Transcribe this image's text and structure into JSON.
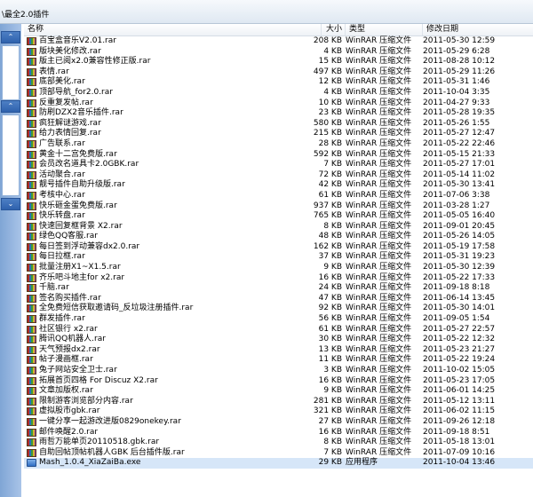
{
  "window": {
    "path": "\\最全2.0插件"
  },
  "columns": {
    "name": "名称",
    "size": "大小",
    "type": "类型",
    "date": "修改日期"
  },
  "nav": {
    "up": "⌃",
    "down": "⌄"
  },
  "files": [
    {
      "name": "百宝盒音乐V2.01.rar",
      "size": "208 KB",
      "type": "WinRAR 压缩文件",
      "date": "2011-05-30 12:59"
    },
    {
      "name": "版块美化修改.rar",
      "size": "4 KB",
      "type": "WinRAR 压缩文件",
      "date": "2011-05-29 6:28"
    },
    {
      "name": "版主已阅x2.0兼容性修正版.rar",
      "size": "15 KB",
      "type": "WinRAR 压缩文件",
      "date": "2011-08-28 10:12"
    },
    {
      "name": "表情.rar",
      "size": "497 KB",
      "type": "WinRAR 压缩文件",
      "date": "2011-05-29 11:26"
    },
    {
      "name": "底部美化.rar",
      "size": "12 KB",
      "type": "WinRAR 压缩文件",
      "date": "2011-05-31 1:46"
    },
    {
      "name": "顶部导航_for2.0.rar",
      "size": "4 KB",
      "type": "WinRAR 压缩文件",
      "date": "2011-10-04 3:35"
    },
    {
      "name": "反重复发帖.rar",
      "size": "10 KB",
      "type": "WinRAR 压缩文件",
      "date": "2011-04-27 9:33"
    },
    {
      "name": "防刷DZX2音乐插件.rar",
      "size": "23 KB",
      "type": "WinRAR 压缩文件",
      "date": "2011-05-28 19:35"
    },
    {
      "name": "疯狂解谜游戏.rar",
      "size": "580 KB",
      "type": "WinRAR 压缩文件",
      "date": "2011-05-26 1:55"
    },
    {
      "name": "给力表情回复.rar",
      "size": "215 KB",
      "type": "WinRAR 压缩文件",
      "date": "2011-05-27 12:47"
    },
    {
      "name": "广告联系.rar",
      "size": "28 KB",
      "type": "WinRAR 压缩文件",
      "date": "2011-05-22 22:46"
    },
    {
      "name": "黄金十二宫免费版.rar",
      "size": "592 KB",
      "type": "WinRAR 压缩文件",
      "date": "2011-05-15 21:33"
    },
    {
      "name": "会员改名道具卡2.0GBK.rar",
      "size": "7 KB",
      "type": "WinRAR 压缩文件",
      "date": "2011-05-27 17:01"
    },
    {
      "name": "活动聚合.rar",
      "size": "72 KB",
      "type": "WinRAR 压缩文件",
      "date": "2011-05-14 11:02"
    },
    {
      "name": "靓号插件自助升级版.rar",
      "size": "42 KB",
      "type": "WinRAR 压缩文件",
      "date": "2011-05-30 13:41"
    },
    {
      "name": "考核中心.rar",
      "size": "61 KB",
      "type": "WinRAR 压缩文件",
      "date": "2011-07-06 3:38"
    },
    {
      "name": "快乐砸金蛋免费版.rar",
      "size": "937 KB",
      "type": "WinRAR 压缩文件",
      "date": "2011-03-28 1:27"
    },
    {
      "name": "快乐转盘.rar",
      "size": "765 KB",
      "type": "WinRAR 压缩文件",
      "date": "2011-05-05 16:40"
    },
    {
      "name": "快速回复框背景 X2.rar",
      "size": "8 KB",
      "type": "WinRAR 压缩文件",
      "date": "2011-09-01 20:45"
    },
    {
      "name": "绿色QQ客服.rar",
      "size": "48 KB",
      "type": "WinRAR 压缩文件",
      "date": "2011-05-26 14:05"
    },
    {
      "name": "每日签到浮动兼容dx2.0.rar",
      "size": "162 KB",
      "type": "WinRAR 压缩文件",
      "date": "2011-05-19 17:58"
    },
    {
      "name": "每日拉框.rar",
      "size": "37 KB",
      "type": "WinRAR 压缩文件",
      "date": "2011-05-31 19:23"
    },
    {
      "name": "批量注册X1~X1.5.rar",
      "size": "9 KB",
      "type": "WinRAR 压缩文件",
      "date": "2011-05-30 12:39"
    },
    {
      "name": "齐乐吧斗地主for x2.rar",
      "size": "16 KB",
      "type": "WinRAR 压缩文件",
      "date": "2011-05-22 17:33"
    },
    {
      "name": "千脑.rar",
      "size": "24 KB",
      "type": "WinRAR 压缩文件",
      "date": "2011-09-18 8:18"
    },
    {
      "name": "签名购买插件.rar",
      "size": "47 KB",
      "type": "WinRAR 压缩文件",
      "date": "2011-06-14 13:45"
    },
    {
      "name": "全免费短信获取邀请码_反垃圾注册插件.rar",
      "size": "92 KB",
      "type": "WinRAR 压缩文件",
      "date": "2011-05-30 14:01"
    },
    {
      "name": "群发插件.rar",
      "size": "56 KB",
      "type": "WinRAR 压缩文件",
      "date": "2011-09-05 1:54"
    },
    {
      "name": "社区银行 x2.rar",
      "size": "61 KB",
      "type": "WinRAR 压缩文件",
      "date": "2011-05-27 22:57"
    },
    {
      "name": "腾讯QQ机器人.rar",
      "size": "30 KB",
      "type": "WinRAR 压缩文件",
      "date": "2011-05-22 12:32"
    },
    {
      "name": "天气预报dx2.rar",
      "size": "13 KB",
      "type": "WinRAR 压缩文件",
      "date": "2011-05-23 21:27"
    },
    {
      "name": "帖子漫画框.rar",
      "size": "11 KB",
      "type": "WinRAR 压缩文件",
      "date": "2011-05-22 19:24"
    },
    {
      "name": "兔子网站安全卫士.rar",
      "size": "3 KB",
      "type": "WinRAR 压缩文件",
      "date": "2011-10-02 15:05"
    },
    {
      "name": "拓展首页四格 For Discuz X2.rar",
      "size": "16 KB",
      "type": "WinRAR 压缩文件",
      "date": "2011-05-23 17:05"
    },
    {
      "name": "文章加版权.rar",
      "size": "9 KB",
      "type": "WinRAR 压缩文件",
      "date": "2011-06-01 14:25"
    },
    {
      "name": "限制游客浏览部分内容.rar",
      "size": "281 KB",
      "type": "WinRAR 压缩文件",
      "date": "2011-05-12 13:11"
    },
    {
      "name": "虚拟股市gbk.rar",
      "size": "321 KB",
      "type": "WinRAR 压缩文件",
      "date": "2011-06-02 11:15"
    },
    {
      "name": "一键分享一起游改进版0829onekey.rar",
      "size": "27 KB",
      "type": "WinRAR 压缩文件",
      "date": "2011-09-26 12:18"
    },
    {
      "name": "邮件唤醒2.0.rar",
      "size": "16 KB",
      "type": "WinRAR 压缩文件",
      "date": "2011-09-18 8:51"
    },
    {
      "name": "雨哲万能单页20110518.gbk.rar",
      "size": "8 KB",
      "type": "WinRAR 压缩文件",
      "date": "2011-05-18 13:01"
    },
    {
      "name": "自助回帖顶帖机器人GBK 后台插件版.rar",
      "size": "7 KB",
      "type": "WinRAR 压缩文件",
      "date": "2011-07-09 10:16"
    },
    {
      "name": "Mash_1.0.4_XiaZaiBa.exe",
      "size": "29 KB",
      "type": "应用程序",
      "date": "2011-10-04 13:46",
      "icon": "exe",
      "selected": true
    }
  ]
}
